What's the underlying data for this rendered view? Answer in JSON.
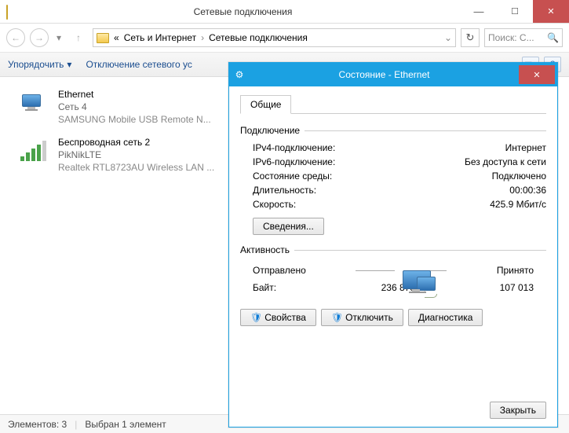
{
  "window": {
    "title": "Сетевые подключения"
  },
  "address": {
    "prefix": "«",
    "crumb1": "Сеть и Интернет",
    "crumb2": "Сетевые подключения"
  },
  "search": {
    "placeholder": "Поиск: С..."
  },
  "toolbar": {
    "organize": "Упорядочить",
    "disable": "Отключение сетевого ус"
  },
  "connections": [
    {
      "name": "Ethernet",
      "network": "Сеть  4",
      "adapter": "SAMSUNG Mobile USB Remote N..."
    },
    {
      "name": "Беспроводная сеть 2",
      "network": "PikNikLTE",
      "adapter": "Realtek RTL8723AU Wireless LAN ..."
    }
  ],
  "statusbar": {
    "items": "Элементов: 3",
    "selected": "Выбран 1 элемент"
  },
  "dialog": {
    "title": "Состояние - Ethernet",
    "tab": "Общие",
    "group_conn": "Подключение",
    "ipv4_label": "IPv4-подключение:",
    "ipv4_value": "Интернет",
    "ipv6_label": "IPv6-подключение:",
    "ipv6_value": "Без доступа к сети",
    "media_label": "Состояние среды:",
    "media_value": "Подключено",
    "dur_label": "Длительность:",
    "dur_value": "00:00:36",
    "speed_label": "Скорость:",
    "speed_value": "425.9 Мбит/с",
    "details_btn": "Сведения...",
    "group_act": "Активность",
    "sent_label": "Отправлено",
    "recv_label": "Принято",
    "bytes_label": "Байт:",
    "bytes_sent": "236 878",
    "bytes_recv": "107 013",
    "props_btn": "Свойства",
    "disable_btn": "Отключить",
    "diag_btn": "Диагностика",
    "close_btn": "Закрыть"
  }
}
